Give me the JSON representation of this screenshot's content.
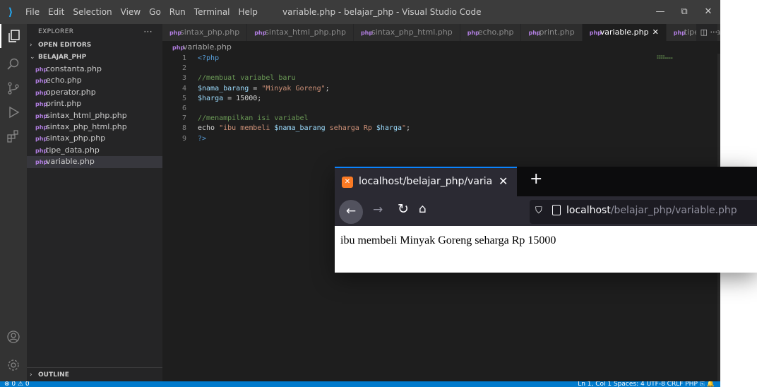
{
  "vscode": {
    "menu": [
      "File",
      "Edit",
      "Selection",
      "View",
      "Go",
      "Run",
      "Terminal",
      "Help"
    ],
    "window_title": "variable.php - belajar_php - Visual Studio Code",
    "window_controls": {
      "minimize": "—",
      "restore": "⧉",
      "close": "✕"
    },
    "explorer_title": "EXPLORER",
    "explorer_more": "···",
    "open_editors_label": "OPEN EDITORS",
    "folder_label": "BELAJAR_PHP",
    "outline_label": "OUTLINE",
    "files": [
      {
        "name": "constanta.php"
      },
      {
        "name": "echo.php"
      },
      {
        "name": "operator.php"
      },
      {
        "name": "print.php"
      },
      {
        "name": "sintax_html_php.php"
      },
      {
        "name": "sintax_php_html.php"
      },
      {
        "name": "sintax_php.php"
      },
      {
        "name": "tipe_data.php"
      },
      {
        "name": "variable.php",
        "selected": true
      }
    ],
    "tabs": [
      {
        "label": "sintax_php.php"
      },
      {
        "label": "sintax_html_php.php"
      },
      {
        "label": "sintax_php_html.php"
      },
      {
        "label": "echo.php"
      },
      {
        "label": "print.php"
      },
      {
        "label": "variable.php",
        "active": true,
        "close": "✕"
      },
      {
        "label": "tipe_data.php"
      }
    ],
    "tab_actions": "◫  ···",
    "breadcrumb": "variable.php",
    "code_lines": [
      "1",
      "2",
      "3",
      "4",
      "5",
      "6",
      "7",
      "8",
      "9"
    ],
    "code": {
      "l1": "<?php",
      "l3": "//membuat variabel baru",
      "l4_var": "$nama_barang",
      "l4_op": " = ",
      "l4_str": "\"Minyak Goreng\"",
      "l4_end": ";",
      "l5_var": "$harga",
      "l5_rest": " = 15000;",
      "l7": "//menampilkan isi variabel",
      "l8_kw": "echo",
      "l8_s1": " \"ibu membeli ",
      "l8_v1": "$nama_barang",
      "l8_s2": " seharga Rp ",
      "l8_v2": "$harga",
      "l8_s3": "\"",
      "l8_end": ";",
      "l9": "?>"
    },
    "status": {
      "left": "⊗ 0 ⚠ 0",
      "right": "Ln 1, Col 1   Spaces: 4   UTF-8   CRLF   PHP   ⎘   🔔"
    },
    "colors": {
      "statusbar": "#007acc",
      "titlebar": "#3c3c3c",
      "editor": "#1e1e1e"
    }
  },
  "browser": {
    "tab_title": "localhost/belajar_php/variable.php",
    "tab_close": "✕",
    "new_tab": "+",
    "url_host": "localhost",
    "url_path": "/belajar_php/variable.php",
    "output": "ibu membeli Minyak Goreng seharga Rp 15000",
    "colors": {
      "accent": "#0a84ff",
      "favicon": "#fb7a24"
    }
  }
}
